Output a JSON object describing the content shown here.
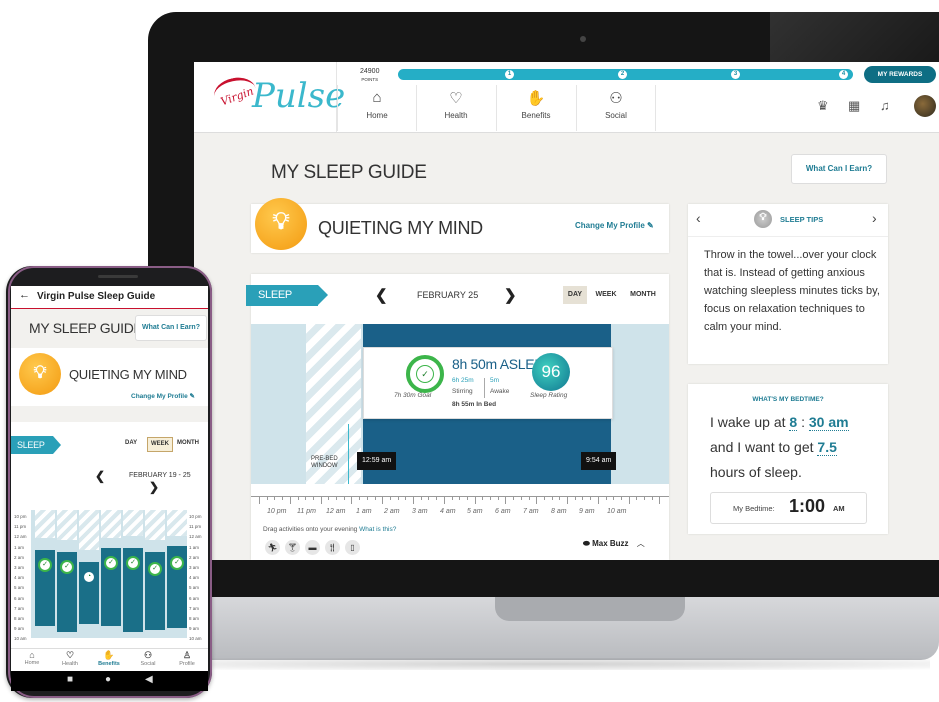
{
  "laptop": {
    "header": {
      "logo_virgin": "Virgin",
      "logo_pulse": "Pulse",
      "points_value": "24900",
      "points_label": "POINTS",
      "progress_levels": [
        "1",
        "2",
        "3",
        "4"
      ],
      "my_rewards_label": "MY REWARDS",
      "nav": [
        {
          "label": "Home",
          "icon": "home-icon"
        },
        {
          "label": "Health",
          "icon": "heart-icon"
        },
        {
          "label": "Benefits",
          "icon": "hand-gift-icon"
        },
        {
          "label": "Social",
          "icon": "people-icon"
        }
      ],
      "right_icons": [
        "trophy-icon",
        "calendar-icon",
        "bell-icon",
        "avatar"
      ]
    },
    "page_title": "MY SLEEP GUIDE",
    "earn_button": "What Can I Earn?",
    "focus_card": {
      "title": "QUIETING MY MIND",
      "change_link": "Change My Profile"
    },
    "sleep_card": {
      "tab": "SLEEP",
      "date": "FEBRUARY 25",
      "ranges": [
        "DAY",
        "WEEK",
        "MONTH"
      ],
      "selected_range": "DAY",
      "asleep_title": "8h 50m ASLEEP",
      "goal_caption": "7h 30m Goal",
      "stirring_value": "6h 25m",
      "stirring_label": "Stirring",
      "awake_value": "5m",
      "awake_label": "Awake",
      "in_bed": "8h 55m In Bed",
      "score": "96",
      "score_caption": "Sleep Rating",
      "prebed_label_1": "PRE-BED",
      "prebed_label_2": "WINDOW",
      "start_time": "12:59 am",
      "end_time": "9:54 am",
      "axis_ticks": [
        "10 pm",
        "11 pm",
        "12 am",
        "1 am",
        "2 am",
        "3 am",
        "4 am",
        "5 am",
        "6 am",
        "7 am",
        "8 am",
        "9 am",
        "10 am"
      ],
      "drag_text": "Drag activities onto your evening",
      "drag_link": "What is this?",
      "activity_icons": [
        "run-icon",
        "cocktail-icon",
        "screen-icon",
        "fork-knife-icon",
        "phone-icon"
      ],
      "max_buzz": "Max Buzz"
    },
    "tips_card": {
      "title": "SLEEP TIPS",
      "body": "Throw in the towel...over your clock that is. Instead of getting anxious watching sleepless minutes ticks by, focus on relaxation techniques to calm your mind."
    },
    "bedtime_card": {
      "title": "WHAT'S MY BEDTIME?",
      "wake_prefix": "I wake up at",
      "wake_hour": "8",
      "wake_sep": ":",
      "wake_min": "30 am",
      "want_prefix": "and I want to get",
      "want_hours": "7.5",
      "hours_suffix": "hours of sleep.",
      "my_bedtime_label": "My Bedtime:",
      "bedtime_value": "1:00",
      "bedtime_ampm": "AM"
    }
  },
  "phone": {
    "app_bar_title": "Virgin Pulse Sleep Guide",
    "page_title": "MY SLEEP GUIDE",
    "earn_button": "What Can I Earn?",
    "focus_title": "QUIETING MY MIND",
    "change_link": "Change My Profile",
    "sleep_tab": "SLEEP",
    "ranges": [
      "DAY",
      "WEEK",
      "MONTH"
    ],
    "selected_range": "WEEK",
    "date_range": "FEBRUARY 19 - 25",
    "time_labels": [
      "10 pm",
      "11 pm",
      "12 am",
      "1 am",
      "2 am",
      "3 am",
      "4 am",
      "5 am",
      "6 am",
      "7 am",
      "8 am",
      "9 am",
      "10 am"
    ],
    "bottom_nav": [
      {
        "label": "Home",
        "icon": "home-icon"
      },
      {
        "label": "Health",
        "icon": "heart-icon"
      },
      {
        "label": "Benefits",
        "icon": "hand-gift-icon"
      },
      {
        "label": "Social",
        "icon": "people-icon"
      },
      {
        "label": "Profile",
        "icon": "person-icon"
      }
    ],
    "selected_nav": "Benefits"
  },
  "colors": {
    "accent": "#2aa0b8",
    "dark_blue": "#1a6088",
    "brand_red": "#c8102e",
    "bulb": "#f39a10",
    "link": "#1f7c93"
  }
}
